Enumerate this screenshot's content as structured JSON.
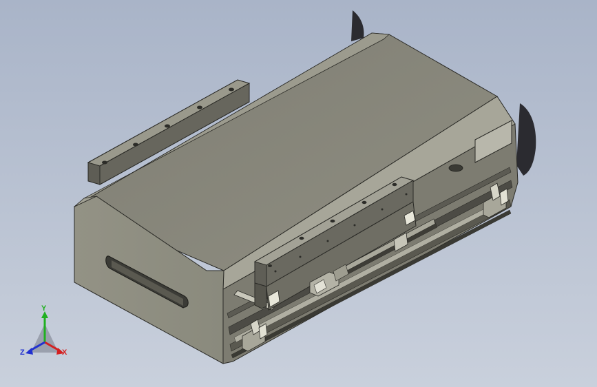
{
  "viewport": {
    "background_top": "#a9b4c8",
    "background_bottom": "#c9d0dc"
  },
  "model": {
    "body_color": "#8e8d80",
    "top_color": "#8b8a7e",
    "side_dark": "#6d6c62",
    "edge_color": "#2a2a26"
  },
  "triad": {
    "x_label": "X",
    "y_label": "Y",
    "z_label": "Z",
    "x_color": "#d42020",
    "y_color": "#20b020",
    "z_color": "#2030d0"
  }
}
